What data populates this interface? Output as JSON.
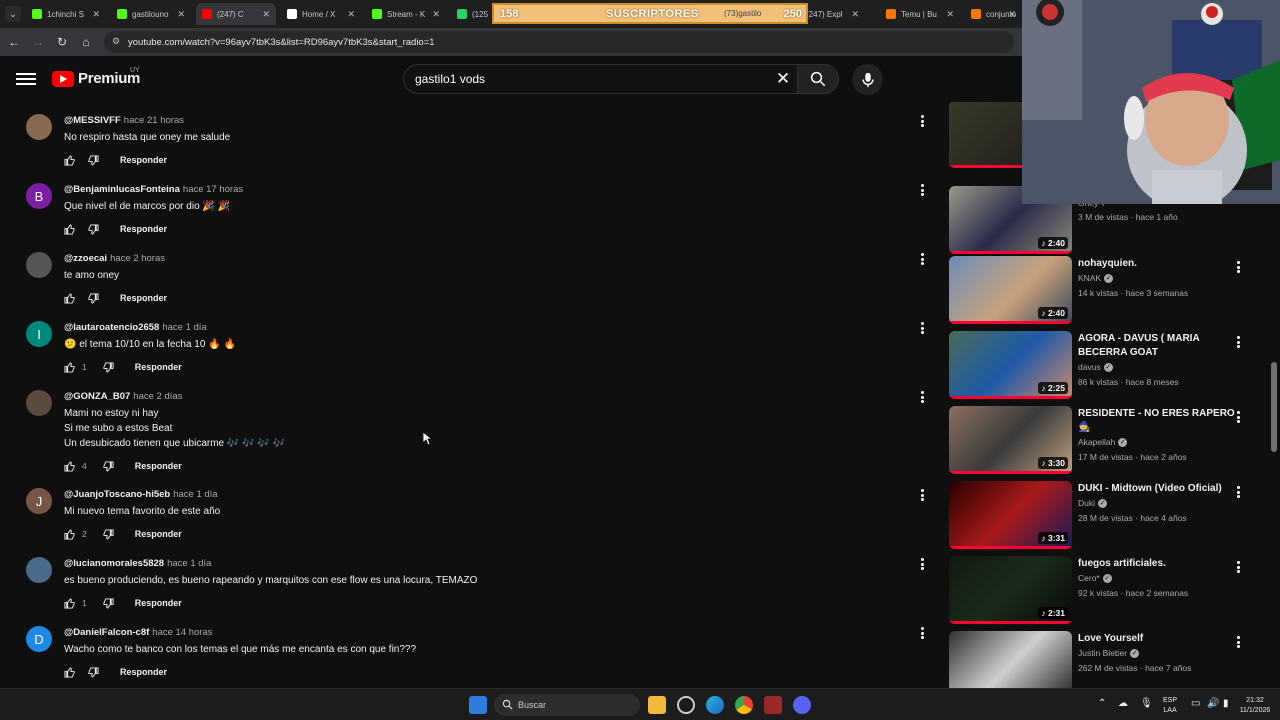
{
  "browser": {
    "tabs": [
      {
        "label": "1chinchi S",
        "icon": "kick-icon",
        "color": "#53fc18"
      },
      {
        "label": "gastilouno",
        "icon": "kick-icon",
        "color": "#53fc18"
      },
      {
        "label": "(247) C",
        "icon": "youtube-icon",
        "color": "#ff0000",
        "active": true
      },
      {
        "label": "Home / X",
        "icon": "x-icon",
        "color": "#ffffff"
      },
      {
        "label": "Stream - K",
        "icon": "kick-icon",
        "color": "#53fc18"
      },
      {
        "label": "(125",
        "icon": "whatsapp-icon",
        "color": "#25d366"
      },
      {
        "label": "(73)gastilo",
        "icon": "tiktok-icon",
        "color": "#ffffff"
      },
      {
        "label": "(247) Expl",
        "icon": "youtube-icon",
        "color": "#ff0000"
      },
      {
        "label": "Temu | Bu",
        "icon": "temu-icon",
        "color": "#fb7701"
      },
      {
        "label": "conjunto",
        "icon": "temu-icon",
        "color": "#fb7701"
      }
    ],
    "url": "youtube.com/watch?v=96ayv7tbK3s&list=RD96ayv7tbK3s&start_radio=1"
  },
  "subscriber_overlay": {
    "current": "158",
    "label": "SUSCRIPTORES",
    "goal": "250",
    "progress": 0.632
  },
  "youtube": {
    "logo_text": "Premium",
    "country": "UY",
    "search_value": "gastilo1 vods"
  },
  "comments": [
    {
      "author": "@MESSIVFF",
      "time": "hace 21 horas",
      "lines": [
        "No respiro hasta que oney me salude"
      ],
      "likes": "",
      "avatar_letter": "",
      "avatar_color": "#8a6a50"
    },
    {
      "author": "@BenjaminlucasFonteina",
      "time": "hace 17 horas",
      "lines": [
        "Que nivel el de marcos por dio 🎉 🎉"
      ],
      "likes": "",
      "avatar_letter": "B",
      "avatar_color": "#7b1fa2"
    },
    {
      "author": "@zzoecai",
      "time": "hace 2 horas",
      "lines": [
        "te amo oney"
      ],
      "likes": "",
      "avatar_letter": "",
      "avatar_color": "#555555"
    },
    {
      "author": "@lautaroatencio2658",
      "time": "hace 1 día",
      "lines": [
        "😕 el tema 10/10 en la fecha 10 🔥 🔥"
      ],
      "likes": "1",
      "avatar_letter": "I",
      "avatar_color": "#00897b"
    },
    {
      "author": "@GONZA_B07",
      "time": "hace 2 días",
      "lines": [
        "Mami no estoy ni hay",
        "Si me subo a estos Beat",
        "Un desubicado tienen que ubicarme 🎶 🎶 🎶 🎶"
      ],
      "likes": "4",
      "avatar_letter": "",
      "avatar_color": "#5a4a40"
    },
    {
      "author": "@JuanjoToscano-hi5eb",
      "time": "hace 1 día",
      "lines": [
        "Mi nuevo tema favorito de este año"
      ],
      "likes": "2",
      "avatar_letter": "J",
      "avatar_color": "#795548"
    },
    {
      "author": "@lucianomorales5828",
      "time": "hace 1 día",
      "lines": [
        "es bueno produciendo, es bueno rapeando y marquitos con ese flow es una locura, TEMAZO"
      ],
      "likes": "1",
      "avatar_letter": "",
      "avatar_color": "#4a6a8a"
    },
    {
      "author": "@DanielFalcon-c8f",
      "time": "hace 14 horas",
      "lines": [
        "Wacho como te banco con los temas el que más me encanta es con que fin???"
      ],
      "likes": "",
      "avatar_letter": "D",
      "avatar_color": "#1e88e5"
    }
  ],
  "reply_label": "Responder",
  "recommendations": [
    {
      "title": "",
      "channel": "Oney T",
      "meta": "3 M de vistas · hace 1 año",
      "duration": "2:40",
      "verified": false
    },
    {
      "title": "nohayquien.",
      "channel": "KNAK",
      "meta": "14 k vistas · hace 3 semanas",
      "duration": "2:40",
      "verified": true
    },
    {
      "title": "AGORA - DAVUS ( MARIA BECERRA GOAT",
      "channel": "davus",
      "meta": "86 k vistas · hace 8 meses",
      "duration": "2:25",
      "verified": true
    },
    {
      "title": "RESIDENTE - NO ERES RAPERO 🧙",
      "channel": "Akapellah",
      "meta": "17 M de vistas · hace 2 años",
      "duration": "3:30",
      "verified": true
    },
    {
      "title": "DUKI - Midtown (Video Oficial)",
      "channel": "Duki",
      "meta": "28 M de vistas · hace 4 años",
      "duration": "3:31",
      "verified": true
    },
    {
      "title": "fuegos artificiales.",
      "channel": "Cero*",
      "meta": "92 k vistas · hace 2 semanas",
      "duration": "2:31",
      "verified": true
    },
    {
      "title": "Love Yourself",
      "channel": "Justin Bieber",
      "meta": "262 M de vistas · hace 7 años",
      "duration": "",
      "verified": true
    }
  ],
  "taskbar": {
    "search_placeholder": "Buscar",
    "lang_top": "ESP",
    "lang_bottom": "LAA",
    "time": "21:32",
    "date": "11/1/2026"
  }
}
